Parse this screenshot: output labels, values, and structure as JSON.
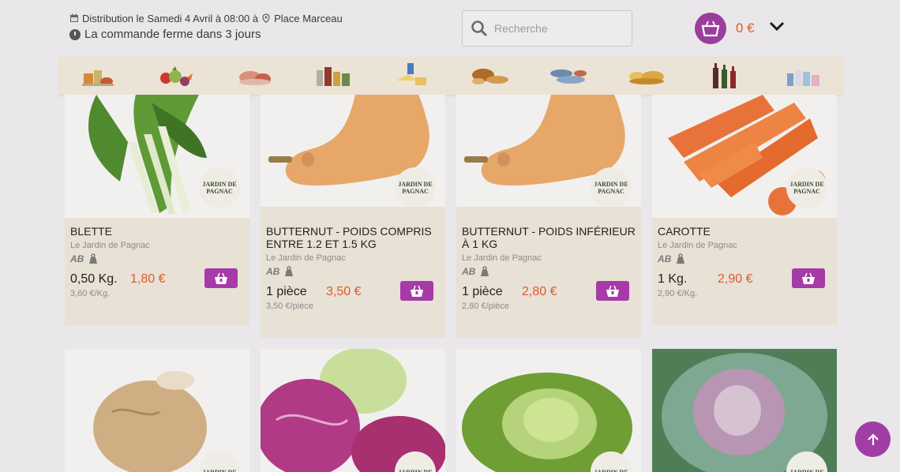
{
  "header": {
    "distribution": "Distribution le Samedi 4 Avril à 08:00 à",
    "location": "Place Marceau",
    "closing": "La commande ferme dans 3 jours",
    "calendar_icon": "calendar-icon",
    "pin_icon": "map-pin-icon",
    "clock_icon": "clock-icon"
  },
  "search": {
    "placeholder": "Recherche",
    "icon": "search-icon"
  },
  "cart": {
    "total": "0 €",
    "icon": "basket-icon",
    "dropdown_icon": "chevron-down-icon"
  },
  "categories": [
    {
      "name": "epicerie-icon"
    },
    {
      "name": "fruits-legumes-icon"
    },
    {
      "name": "viandes-icon"
    },
    {
      "name": "conserves-icon"
    },
    {
      "name": "produits-laitiers-icon"
    },
    {
      "name": "boulangerie-icon"
    },
    {
      "name": "poissons-icon"
    },
    {
      "name": "fromages-icon"
    },
    {
      "name": "boissons-icon"
    },
    {
      "name": "hygiene-icon"
    }
  ],
  "producer_logo": {
    "line1": "JARDIN DE",
    "line2": "PAGNAC"
  },
  "products": [
    {
      "name": "BLETTE",
      "farm": "Le Jardin de Pagnac",
      "qty": "0,50 Kg.",
      "price": "1,80 €",
      "unit": "3,60 €/Kg."
    },
    {
      "name": "BUTTERNUT - POIDS COMPRIS ENTRE 1.2 ET 1.5 KG",
      "farm": "Le Jardin de Pagnac",
      "qty": "1 pièce",
      "price": "3,50 €",
      "unit": "3,50 €/pièce"
    },
    {
      "name": "BUTTERNUT - POIDS INFÉRIEUR À 1 KG",
      "farm": "Le Jardin de Pagnac",
      "qty": "1 pièce",
      "price": "2,80 €",
      "unit": "2,80 €/pièce"
    },
    {
      "name": "CAROTTE",
      "farm": "Le Jardin de Pagnac",
      "qty": "1 Kg.",
      "price": "2,90 €",
      "unit": "2,90 €/Kg."
    }
  ],
  "labels": {
    "organic": "AB"
  },
  "colors": {
    "accent": "#a63aa8",
    "price": "#e05a2b",
    "card_bg": "#e7e1d6"
  }
}
